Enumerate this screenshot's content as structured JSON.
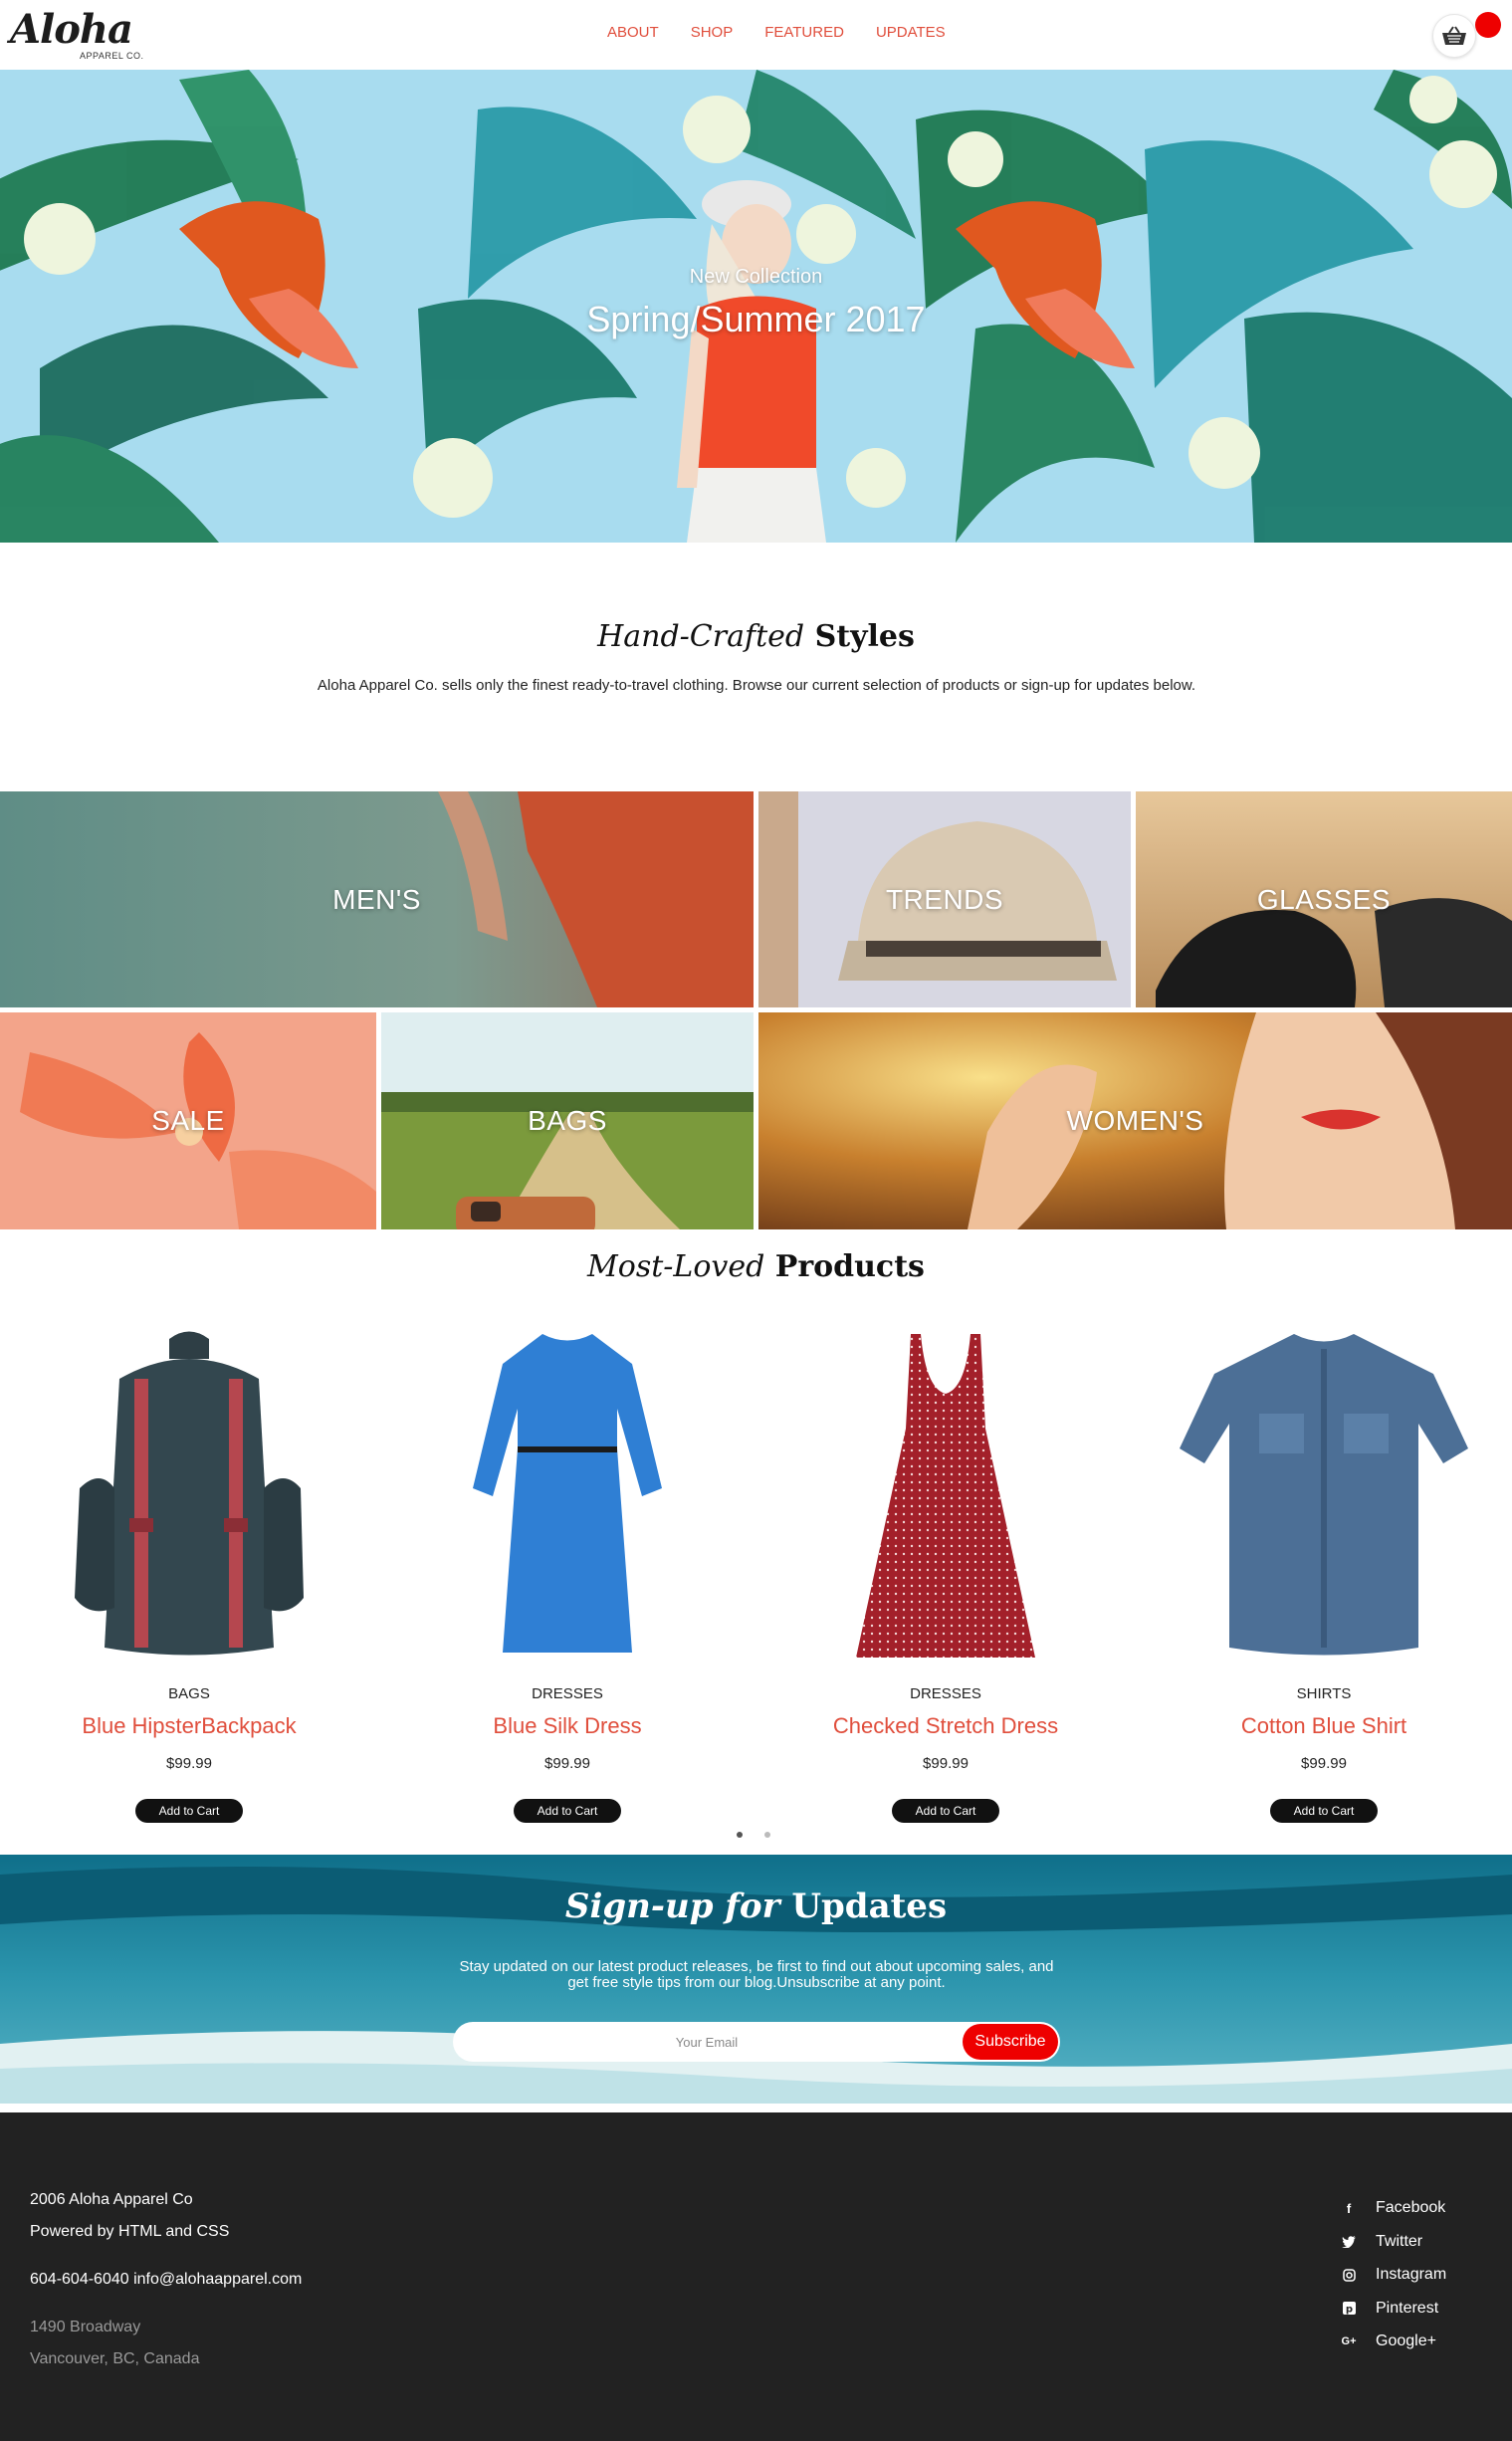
{
  "brand": {
    "logo_script": "Aloha",
    "logo_sub": "APPAREL CO."
  },
  "nav": {
    "items": [
      {
        "label": "ABOUT"
      },
      {
        "label": "SHOP"
      },
      {
        "label": "FEATURED"
      },
      {
        "label": "UPDATES"
      }
    ]
  },
  "cart": {
    "icon": "basket-icon",
    "badge_color": "#ee0000"
  },
  "hero": {
    "subtitle": "New Collection",
    "title": "Spring/Summer 2017"
  },
  "intro": {
    "heading_italic": "Hand-Crafted",
    "heading_bold": "Styles",
    "text": "Aloha Apparel Co. sells only the finest ready-to-travel clothing. Browse our current selection of products or sign-up for updates below."
  },
  "categories": [
    {
      "label": "MEN'S"
    },
    {
      "label": "TRENDS"
    },
    {
      "label": "GLASSES"
    },
    {
      "label": "SALE"
    },
    {
      "label": "BAGS"
    },
    {
      "label": "WOMEN'S"
    }
  ],
  "products_section": {
    "heading_italic": "Most-Loved",
    "heading_bold": "Products"
  },
  "products": [
    {
      "category": "BAGS",
      "name": "Blue HipsterBackpack",
      "price": "$99.99",
      "button": "Add to Cart"
    },
    {
      "category": "DRESSES",
      "name": "Blue Silk Dress",
      "price": "$99.99",
      "button": "Add to Cart"
    },
    {
      "category": "DRESSES",
      "name": "Checked Stretch Dress",
      "price": "$99.99",
      "button": "Add to Cart"
    },
    {
      "category": "SHIRTS",
      "name": "Cotton Blue Shirt",
      "price": "$99.99",
      "button": "Add to Cart"
    }
  ],
  "carousel": {
    "active_page": 1,
    "page_count": 2
  },
  "signup": {
    "heading_italic": "Sign-up for",
    "heading_bold": "Updates",
    "text": "Stay updated on our latest product releases, be first to find out about upcoming sales, and get free style tips from our blog.Unsubscribe at any point.",
    "placeholder": "Your Email",
    "button": "Subscribe"
  },
  "footer": {
    "copyright": "2006 Aloha Apparel Co",
    "powered": "Powered by HTML and CSS",
    "contact": "604-604-6040 info@alohaapparel.com",
    "address1": "1490 Broadway",
    "address2": "Vancouver, BC, Canada",
    "social": [
      {
        "icon": "facebook-icon",
        "label": "Facebook"
      },
      {
        "icon": "twitter-icon",
        "label": "Twitter"
      },
      {
        "icon": "instagram-icon",
        "label": "Instagram"
      },
      {
        "icon": "pinterest-icon",
        "label": "Pinterest"
      },
      {
        "icon": "google-plus-icon",
        "label": "Google+"
      }
    ]
  },
  "colors": {
    "accent": "#e04e3c",
    "subscribe": "#ee0000",
    "footer_bg": "#222222"
  }
}
